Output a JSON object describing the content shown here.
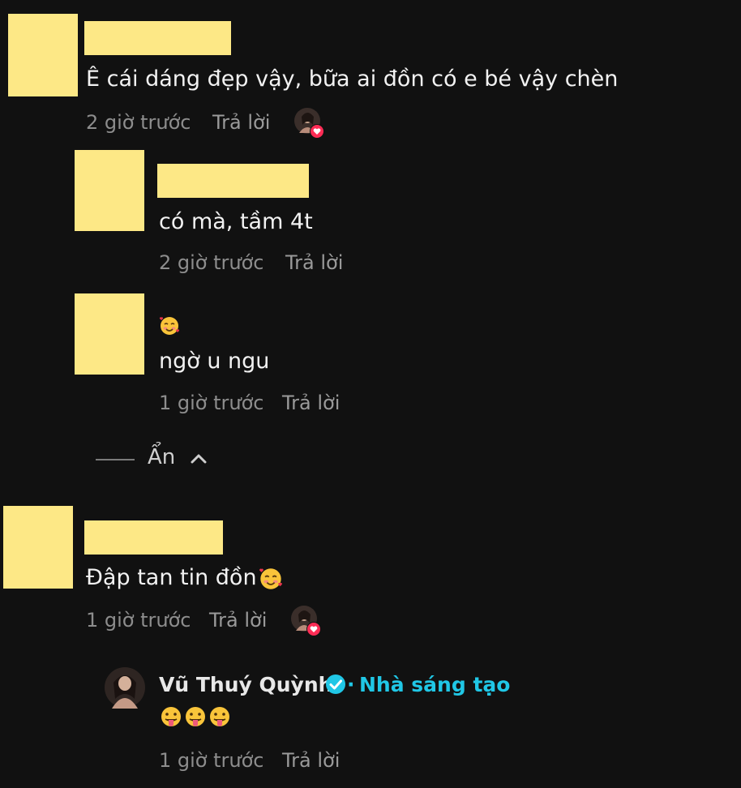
{
  "colors": {
    "background": "#111111",
    "redacted": "#fde886",
    "creator_accent": "#20c7e6",
    "heart_badge": "#fe2c55"
  },
  "comments": [
    {
      "text": "Ê cái dáng đẹp vậy, bữa ai đồn có e bé vậy chèn",
      "time": "2 giờ trước",
      "reply_label": "Trả lời",
      "liked_by_creator": true,
      "replies": [
        {
          "text": "có mà, tầm 4t",
          "time": "2 giờ trước",
          "reply_label": "Trả lời"
        },
        {
          "name_emoji": "smiling-face-with-hearts",
          "text": "ngờ u ngu",
          "time": "1 giờ trước",
          "reply_label": "Trả lời"
        }
      ]
    },
    {
      "text": "Đập tan tin đồn",
      "trailing_emoji": "smiling-face-with-hearts",
      "time": "1 giờ trước",
      "reply_label": "Trả lời",
      "liked_by_creator": true,
      "replies": [
        {
          "author": "Vũ Thuý Quỳnh",
          "verified": true,
          "separator": "·",
          "tag": "Nhà sáng tạo",
          "text_emojis": [
            "face-with-tongue",
            "face-with-tongue",
            "face-with-tongue"
          ],
          "time": "1 giờ trước",
          "reply_label": "Trả lời"
        }
      ]
    }
  ],
  "hide_replies": {
    "label": "Ẩn",
    "icon": "chevron-up-icon"
  }
}
